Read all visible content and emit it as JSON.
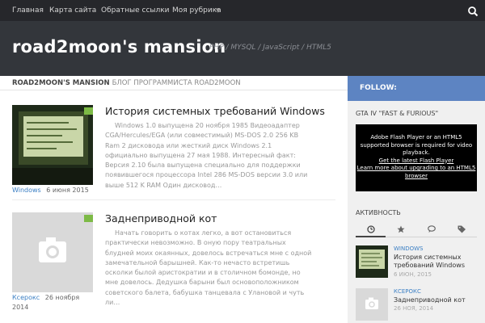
{
  "nav": {
    "items": [
      "Главная",
      "Карта сайта",
      "Обратные ссылки",
      "Моя рубрика"
    ],
    "search_icon": "search-icon"
  },
  "header": {
    "title": "road2moon's mansion",
    "tagline": "PHP / MYSQL / JavaScript / HTML5"
  },
  "breadcrumb": {
    "site": "ROAD2MOON'S MANSION",
    "subtitle": "БЛОГ ПРОГРАММИСТА ROAD2MOON"
  },
  "posts": [
    {
      "title": "История системных требований Windows",
      "excerpt": "Windows 1.0 выпущена 20 ноября 1985 Видеоадаптер CGA/Hercules/EGA (или совместимый) MS-DOS 2.0 256 KB Ram 2 дисковода или жесткий диск Windows 2.1 официально выпущена 27 мая 1988. Интересный факт: Версия 2.10 была выпущена специально для поддержки появившегося процессора Intel 286 MS-DOS версии 3.0 или выше 512 K RAM Один дисковод…",
      "category": "Windows",
      "date": "6 июня 2015"
    },
    {
      "title": "Заднеприводной кот",
      "excerpt": "Начать говорить о котах легко, а вот остановиться практически невозможно. В оную пору театральных блудней моих окаянных, довелось встречаться мне с одной замечательной барышней. Как-то нечасто встретишь осколки былой аристократии и в столичном бомонде, но мне довелось. Дедушка барыни был основоположником советского балета, бабушка танцевала с Улановой и чуть ли…",
      "category": "Ксерокс",
      "date": "26 ноября 2014"
    }
  ],
  "sidebar": {
    "follow": "FOLLOW:",
    "video_widget_title": "GTA IV \"FAST & FURIOUS\"",
    "flash_text": "Adobe Flash Player or an HTML5 supported browser is required for video playback.",
    "flash_link1": "Get the latest Flash Player",
    "flash_link2": "Learn more about upgrading to an HTML5 browser",
    "activity_title": "АКТИВНОСТЬ",
    "tabs": [
      "clock-icon",
      "star-icon",
      "comments-icon",
      "tags-icon"
    ],
    "items": [
      {
        "category": "WINDOWS",
        "title": "История системных требований Windows",
        "date": "6 ИЮН, 2015"
      },
      {
        "category": "КСЕРОКС",
        "title": "Заднеприводной кот",
        "date": "26 НОЯ, 2014"
      }
    ]
  },
  "colors": {
    "nav_bg": "#26272b",
    "header_bg": "#33363b",
    "follow_bg": "#5d84c2",
    "link": "#3b7fc4",
    "badge": "#7dba46"
  }
}
